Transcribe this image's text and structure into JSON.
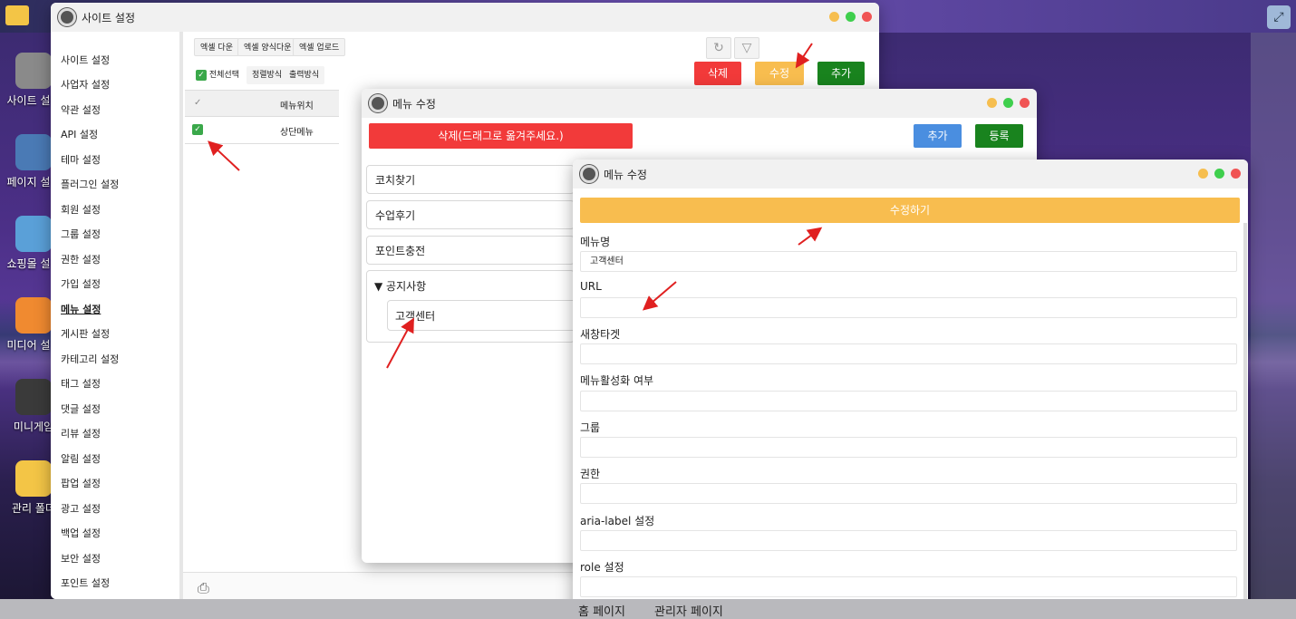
{
  "desktop": {
    "icons": [
      {
        "label": "사이트 설정",
        "color": "#8a8a8a"
      },
      {
        "label": "페이지 설정",
        "color": "#4a7ab5"
      },
      {
        "label": "쇼핑몰 설정",
        "color": "#5aa0d8"
      },
      {
        "label": "미디어 설정",
        "color": "#f08a30"
      },
      {
        "label": "미니게임",
        "color": "#3a3a3a"
      },
      {
        "label": "관리 폴더",
        "color": "#f3c546"
      }
    ],
    "taskbar": {
      "home": "홈 페이지",
      "admin": "관리자 페이지"
    }
  },
  "window1": {
    "title": "사이트 설정",
    "sidebar": [
      "사이트 설정",
      "사업자 설정",
      "약관 설정",
      "API 설정",
      "테마 설정",
      "플러그인 설정",
      "회원 설정",
      "그룹 설정",
      "권한 설정",
      "가입 설정",
      "메뉴 설정",
      "게시판 설정",
      "카테고리 설정",
      "태그 설정",
      "댓글 설정",
      "리뷰 설정",
      "알림 설정",
      "팝업 설정",
      "광고 설정",
      "백업 설정",
      "보안 설정",
      "포인트 설정"
    ],
    "active_sidebar": "메뉴 설정",
    "toolbar": {
      "excel_down": "엑셀 다운",
      "excel_template": "엑셀 양식다운",
      "excel_upload": "엑셀 업로드"
    },
    "select_all": "전체선택",
    "sort": "정렬방식",
    "output": "출력방식",
    "buttons": {
      "delete": "삭제",
      "edit": "수정",
      "add": "추가"
    },
    "grid": {
      "column": "메뉴위치",
      "row": "상단메뉴"
    }
  },
  "window2": {
    "title": "메뉴 수정",
    "delete_drag": "삭제(드래그로 옮겨주세요.)",
    "add": "추가",
    "register": "등록",
    "menus": [
      "코치찾기",
      "수업후기",
      "포인트충전"
    ],
    "group": {
      "label": "▼ 공지사항",
      "child": "고객센터"
    }
  },
  "window3": {
    "title": "메뉴 수정",
    "submit": "수정하기",
    "fields": [
      {
        "label": "메뉴명",
        "value": "고객센터"
      },
      {
        "label": "URL",
        "value": ""
      },
      {
        "label": "새창타겟",
        "value": ""
      },
      {
        "label": "메뉴활성화 여부",
        "value": ""
      },
      {
        "label": "그룹",
        "value": ""
      },
      {
        "label": "권한",
        "value": ""
      },
      {
        "label": "aria-label 설정",
        "value": ""
      },
      {
        "label": "role 설정",
        "value": ""
      }
    ]
  },
  "colors": {
    "red": "#f23a3a",
    "orange": "#f8bd4f",
    "green": "#19831e",
    "blue": "#4a8ee0",
    "annotation": "#e02020"
  }
}
